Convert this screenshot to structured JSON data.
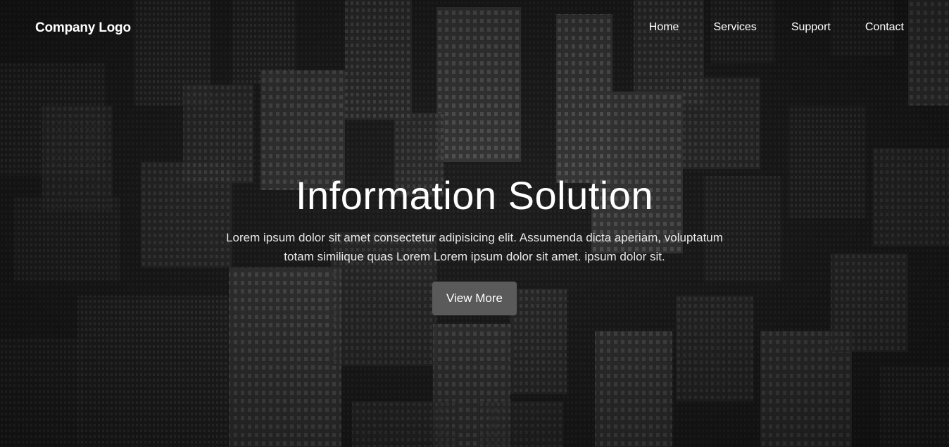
{
  "header": {
    "logo_text": "Company Logo",
    "nav": [
      {
        "label": "Home"
      },
      {
        "label": "Services"
      },
      {
        "label": "Support"
      },
      {
        "label": "Contact"
      }
    ]
  },
  "hero": {
    "title": "Information Solution",
    "description": "Lorem ipsum dolor sit amet consectetur adipisicing elit. Assumenda dicta aperiam, voluptatum totam similique quas Lorem Lorem ipsum dolor sit amet. ipsum dolor sit.",
    "cta_label": "View More"
  },
  "colors": {
    "text": "#ffffff",
    "button_bg": "#5a5a5a",
    "background": "#1a1a1a"
  }
}
